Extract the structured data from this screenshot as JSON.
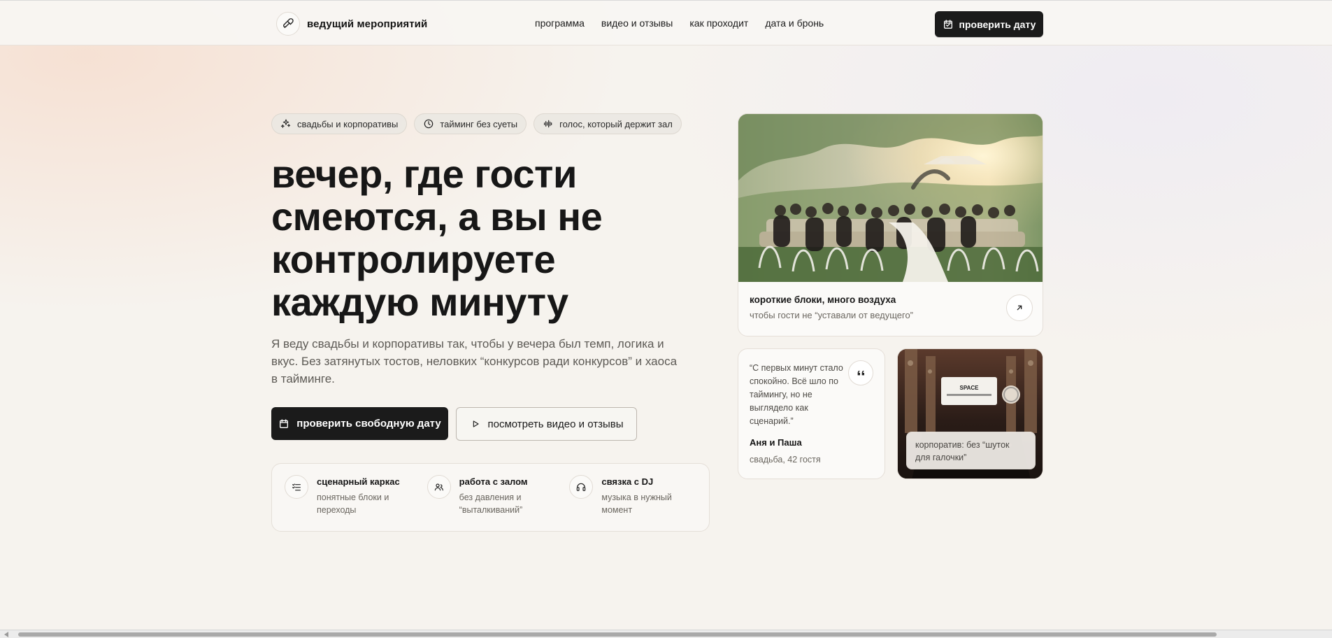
{
  "header": {
    "brand_title": "ведущий мероприятий",
    "nav": [
      "программа",
      "видео и отзывы",
      "как проходит",
      "дата и бронь"
    ],
    "cta": "проверить дату",
    "icons": {
      "brand": "microphone-icon",
      "cta": "calendar-icon"
    }
  },
  "hero": {
    "chips": [
      {
        "label": "свадьбы и корпоративы",
        "icon": "sparkles-icon"
      },
      {
        "label": "тайминг без суеты",
        "icon": "clock-icon"
      },
      {
        "label": "голос, который держит зал",
        "icon": "waveform-icon"
      }
    ],
    "title": "вечер, где гости\nсмеются, а вы не\nконтролируете\nкаждую минуту",
    "text": "Я веду свадьбы и корпоративы так, чтобы у вечера был темп, логика и вкус. Без затянутых тостов, неловких “конкурсов ради конкурсов” и хаоса в тайминге.",
    "buttons": {
      "primary": "проверить свободную дату",
      "secondary": "посмотреть видео и отзывы"
    },
    "features": [
      {
        "title": "сценарный каркас",
        "desc": "понятные блоки и\nпереходы",
        "icon": "list-check-icon"
      },
      {
        "title": "работа с залом",
        "desc": "без давления и\n“выталкиваний”",
        "icon": "users-icon"
      },
      {
        "title": "связка с DJ",
        "desc": "музыка в нужный\nмомент",
        "icon": "headphones-icon"
      }
    ]
  },
  "cards": {
    "top": {
      "caption_title": "короткие блоки, много воздуха",
      "caption_sub": "чтобы гости не “уставали от ведущего”",
      "arrow_icon": "arrow-up-right-icon"
    },
    "quote": {
      "text": "“С первых минут стало спокойно. Всё шло по таймингу, но не выглядело как сценарий.”",
      "author": "Аня и Паша",
      "event": "свадьба, 42 гостя",
      "icon": "quote-icon"
    },
    "corporate": {
      "badge": "корпоратив: без “шуток для галочки”",
      "screen_text": "SPACE"
    }
  },
  "colors": {
    "background": "#f6f3ee",
    "dark_button": "#1b1b1b",
    "border": "#e5dfd8",
    "muted_text": "#6a665f"
  }
}
